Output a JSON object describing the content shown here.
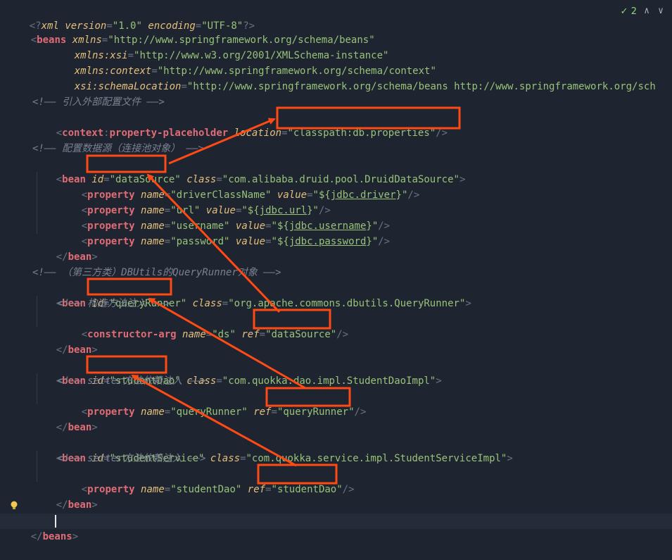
{
  "inspection": {
    "count": "2",
    "check_glyph": "✓",
    "up_glyph": "∧",
    "down_glyph": "∨"
  },
  "code": {
    "l1": {
      "decl_open": "<?",
      "xml": "xml",
      "version_attr": "version",
      "eq": "=",
      "version_val": "\"1.0\"",
      "encoding_attr": "encoding",
      "encoding_val": "\"UTF-8\"",
      "decl_close": "?>"
    },
    "l2": {
      "open": "<",
      "tag": "beans",
      "attr": "xmlns",
      "val": "\"http://www.springframework.org/schema/beans\""
    },
    "l3": {
      "attr_ns": "xmlns:",
      "attr_local": "xsi",
      "val": "\"http://www.w3.org/2001/XMLSchema-instance\""
    },
    "l4": {
      "attr_ns": "xmlns:",
      "attr_local": "context",
      "val": "\"http://www.springframework.org/schema/context\""
    },
    "l5": {
      "attr_ns": "xsi:",
      "attr_local": "schemaLocation",
      "val": "\"http://www.springframework.org/schema/beans http://www.springframework.org/sch"
    },
    "c1": "<!—— 引入外部配置文件 ——>",
    "l7": {
      "open": "<",
      "ns": "context",
      "colon": ":",
      "tag": "property-placeholder",
      "attr": "location",
      "val": "\"classpath:db.properties\"",
      "close": "/>"
    },
    "c2": "<!—— 配置数据源（连接池对象） ——>",
    "l9": {
      "tag": "bean",
      "id_attr": "id",
      "id_val": "\"dataSource\"",
      "class_attr": "class",
      "class_val": "\"com.alibaba.druid.pool.DruidDataSource\"",
      "close": ">"
    },
    "p1": {
      "tag": "property",
      "name_attr": "name",
      "name_val": "\"driverClassName\"",
      "value_attr": "value",
      "q_open": "\"${",
      "expr": "jdbc.driver",
      "q_close": "}\"",
      "close": "/>"
    },
    "p2": {
      "tag": "property",
      "name_attr": "name",
      "name_val": "\"url\"",
      "value_attr": "value",
      "q_open": "\"${",
      "expr": "jdbc.url",
      "q_close": "}\"",
      "close": "/>"
    },
    "p3": {
      "tag": "property",
      "name_attr": "name",
      "name_val": "\"username\"",
      "value_attr": "value",
      "q_open": "\"${",
      "expr": "jdbc.username",
      "q_close": "}\"",
      "close": "/>"
    },
    "p4": {
      "tag": "property",
      "name_attr": "name",
      "name_val": "\"password\"",
      "value_attr": "value",
      "q_open": "\"${",
      "expr": "jdbc.password",
      "q_close": "}\"",
      "close": "/>"
    },
    "end_bean": {
      "open": "</",
      "tag": "bean",
      "close": ">"
    },
    "c3": "<!—— （第三方类）DBUtils的QueryRunner对象 ——>",
    "l17": {
      "tag": "bean",
      "id_attr": "id",
      "id_val": "\"queryRunner\"",
      "class_attr": "class",
      "class_val": "\"org.apache.commons.dbutils.QueryRunner\"",
      "close": ">"
    },
    "c4": "<!—— 构造方法注入 ——>",
    "l19": {
      "tag": "constructor-arg",
      "name_attr": "name",
      "name_val": "\"ds\"",
      "ref_attr": "ref",
      "ref_val": "\"dataSource\"",
      "close": "/>"
    },
    "l22": {
      "tag": "bean",
      "id_attr": "id",
      "id_val": "\"studentDao\"",
      "class_attr": "class",
      "class_val": "\"com.quokka.dao.impl.StudentDaoImpl\"",
      "close": ">"
    },
    "c5": "<!—— setter方法依赖注入 ——>",
    "l24": {
      "tag": "property",
      "name_attr": "name",
      "name_val": "\"queryRunner\"",
      "ref_attr": "ref",
      "ref_val": "\"queryRunner\"",
      "close": "/>"
    },
    "l27": {
      "tag": "bean",
      "id_attr": "id",
      "id_val": "\"studentService\"",
      "class_attr": "class",
      "class_val": "\"com.quokka.service.impl.StudentServiceImpl\"",
      "close": ">"
    },
    "c6": "<!—— setter方法依赖注入 ——>",
    "l29": {
      "tag": "property",
      "name_attr": "name",
      "name_val": "\"studentDao\"",
      "ref_attr": "ref",
      "ref_val": "\"studentDao\"",
      "close": "/>"
    },
    "end_beans": {
      "open": "</",
      "tag": "beans",
      "close": ">"
    }
  },
  "colors": {
    "highlight": "#ff4a14",
    "background": "#1e2430",
    "tag": "#e06c75",
    "string": "#98c379",
    "attribute": "#e5c07b"
  }
}
